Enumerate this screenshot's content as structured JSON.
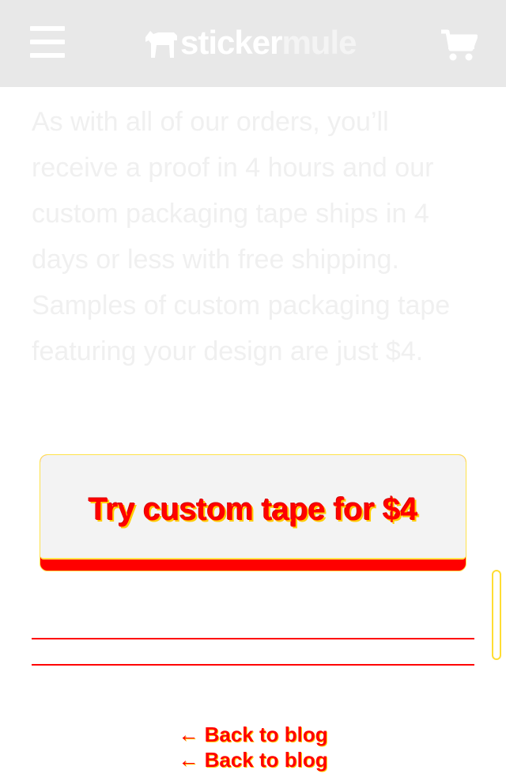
{
  "header": {
    "logo": {
      "part1": "sticker",
      "part2": "mule"
    },
    "menu_icon": "hamburger-icon",
    "cart_icon": "cart-icon"
  },
  "article": {
    "paragraph": "As with all of our orders, you’ll receive a proof in 4 hours and our custom packaging tape ships in 4 days or less with free shipping. Samples of custom packaging tape featuring your design are just $4."
  },
  "cta": {
    "label": "Try custom tape for $4"
  },
  "footer": {
    "back_link": "← Back to blog"
  },
  "colors": {
    "header_bg": "#e8e8e8",
    "accent": "#ff0000",
    "highlight": "#ffcc00",
    "button_face": "#f3f3f3"
  }
}
